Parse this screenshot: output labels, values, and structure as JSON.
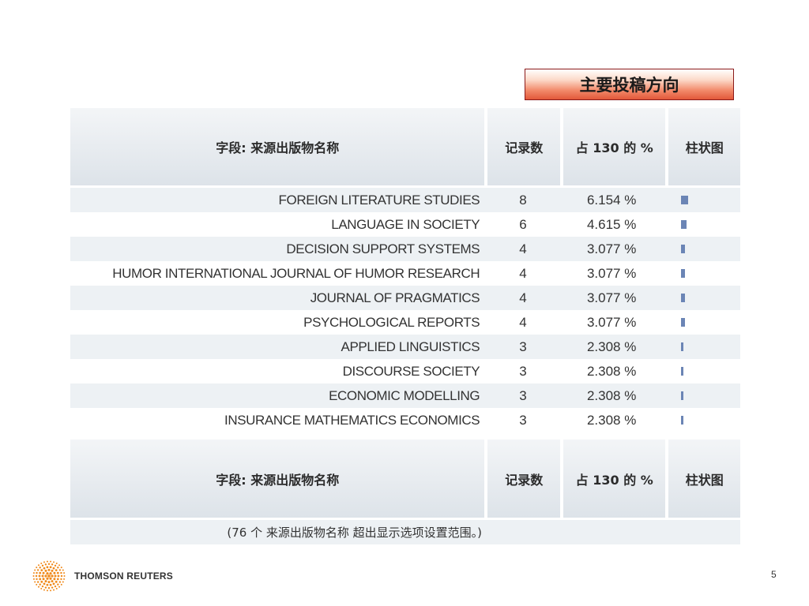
{
  "title": "主要投稿方向",
  "header": {
    "field": "字段: 来源出版物名称",
    "count": "记录数",
    "percent": "占 130 的 %",
    "bar": "柱状图"
  },
  "rows": [
    {
      "name": "FOREIGN LITERATURE STUDIES",
      "count": "8",
      "percent": "6.154 %",
      "value": 6.154
    },
    {
      "name": "LANGUAGE IN SOCIETY",
      "count": "6",
      "percent": "4.615 %",
      "value": 4.615
    },
    {
      "name": "DECISION SUPPORT SYSTEMS",
      "count": "4",
      "percent": "3.077 %",
      "value": 3.077
    },
    {
      "name": "HUMOR INTERNATIONAL JOURNAL OF HUMOR RESEARCH",
      "count": "4",
      "percent": "3.077 %",
      "value": 3.077
    },
    {
      "name": "JOURNAL OF PRAGMATICS",
      "count": "4",
      "percent": "3.077 %",
      "value": 3.077
    },
    {
      "name": "PSYCHOLOGICAL REPORTS",
      "count": "4",
      "percent": "3.077 %",
      "value": 3.077
    },
    {
      "name": "APPLIED LINGUISTICS",
      "count": "3",
      "percent": "2.308 %",
      "value": 2.308
    },
    {
      "name": "DISCOURSE SOCIETY",
      "count": "3",
      "percent": "2.308 %",
      "value": 2.308
    },
    {
      "name": "ECONOMIC MODELLING",
      "count": "3",
      "percent": "2.308 %",
      "value": 2.308
    },
    {
      "name": "INSURANCE MATHEMATICS ECONOMICS",
      "count": "3",
      "percent": "2.308 %",
      "value": 2.308
    }
  ],
  "note": "(76 个 来源出版物名称 超出显示选项设置范围。)",
  "footer": {
    "brand": "THOMSON REUTERS",
    "page_number": "5"
  },
  "colors": {
    "bar": "#6b85b5",
    "row_shade": "#edf1f4",
    "title_accent": "#e2583a"
  }
}
